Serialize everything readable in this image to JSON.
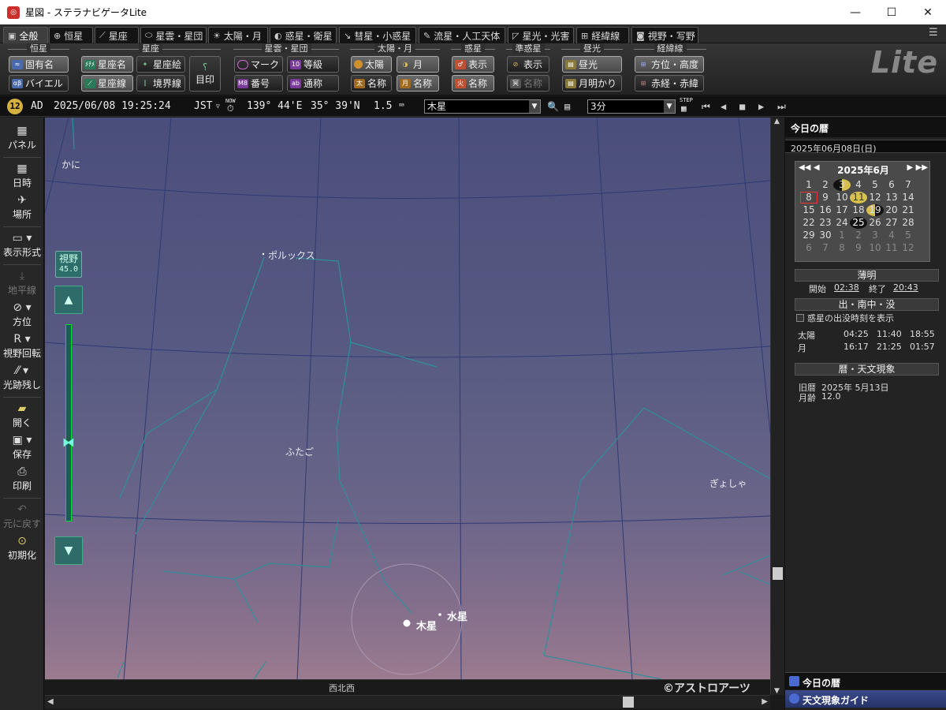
{
  "window": {
    "title": "星図 - ステラナビゲータLite",
    "icon": "stellanavi-app-icon"
  },
  "tabs": [
    {
      "label": "全般",
      "icon": "general-icon",
      "active": true
    },
    {
      "label": "恒星",
      "icon": "star-crosshair-icon"
    },
    {
      "label": "星座",
      "icon": "constellation-icon"
    },
    {
      "label": "星雲・星団",
      "icon": "nebula-icon"
    },
    {
      "label": "太陽・月",
      "icon": "sun-icon"
    },
    {
      "label": "惑星・衛星",
      "icon": "planet-icon"
    },
    {
      "label": "彗星・小惑星",
      "icon": "comet-icon"
    },
    {
      "label": "流星・人工天体",
      "icon": "meteor-icon"
    },
    {
      "label": "星光・光害",
      "icon": "starlight-icon"
    },
    {
      "label": "経緯線",
      "icon": "grid-icon"
    },
    {
      "label": "視野・写野",
      "icon": "camera-icon"
    }
  ],
  "ribbon": {
    "groups": {
      "star": "恒星",
      "constellation": "星座",
      "nebula": "星雲・星団",
      "sunmoon": "太陽・月",
      "planet": "惑星",
      "dwarf": "準惑星",
      "twilight": "昼光",
      "grid": "経緯線"
    },
    "buttons": {
      "proper_name": "固有名",
      "bayer": "バイエル",
      "const_name": "星座名",
      "const_line": "星座線",
      "const_art": "星座絵",
      "boundary": "境界線",
      "mark": "目印",
      "neb_mark": "マーク",
      "neb_number": "番号",
      "neb_magnitude": "等級",
      "neb_common": "通称",
      "sun": "太陽",
      "moon": "月",
      "sun_name": "名称",
      "moon_name": "名称",
      "planet_show": "表示",
      "planet_name": "名称",
      "dwarf_show": "表示",
      "dwarf_name": "名称",
      "daylight": "昼光",
      "moonlight": "月明かり",
      "altaz": "方位・高度",
      "radec": "赤経・赤緯"
    },
    "logo": "Lite"
  },
  "infobar": {
    "badge": "12",
    "era": "AD",
    "datetime": "2025/06/08 19:25:24",
    "tz": "JST",
    "now_label": "NOW",
    "longitude": "139° 44'E",
    "latitude": "35° 39'N",
    "speed": "1.5",
    "target": "木星",
    "step": "3分",
    "step_label": "STEP"
  },
  "leftbar": {
    "panel": "パネル",
    "datetime": "日時",
    "place": "場所",
    "display": "表示形式",
    "horizon": "地平線",
    "direction": "方位",
    "rotate": "視野回転",
    "trail": "光跡残し",
    "open": "開く",
    "save": "保存",
    "print": "印刷",
    "undo": "元に戻す",
    "reset": "初期化"
  },
  "sky": {
    "fov_label": "視野",
    "fov_value": "45.0",
    "labels": {
      "kani": "かに",
      "pollux": "ポルックス",
      "futago": "ふたご",
      "gyosha": "ぎょしゃ",
      "jupiter": "木星",
      "mercury": "水星"
    },
    "direction": "西北西",
    "copyright": "©アストロアーツ"
  },
  "right_panel": {
    "title": "今日の暦",
    "date": "2025年06月08日(日)",
    "calendar": {
      "month": "2025年6月",
      "days": [
        [
          "",
          "",
          "",
          "",
          "",
          "",
          ""
        ],
        [
          "1",
          "2",
          "3",
          "4",
          "5",
          "6",
          "7"
        ],
        [
          "8",
          "9",
          "10",
          "11",
          "12",
          "13",
          "14"
        ],
        [
          "15",
          "16",
          "17",
          "18",
          "19",
          "20",
          "21"
        ],
        [
          "22",
          "23",
          "24",
          "25",
          "26",
          "27",
          "28"
        ],
        [
          "29",
          "30",
          "1",
          "2",
          "3",
          "4",
          "5"
        ],
        [
          "6",
          "7",
          "8",
          "9",
          "10",
          "11",
          "12"
        ]
      ]
    },
    "twilight": {
      "head": "薄明",
      "start_label": "開始",
      "start": "02:38",
      "end_label": "終了",
      "end": "20:43"
    },
    "rise_set": {
      "head": "出・南中・没",
      "checkbox": "惑星の出没時刻を表示",
      "rows": [
        {
          "name": "太陽",
          "rise": "04:25",
          "transit": "11:40",
          "set": "18:55"
        },
        {
          "name": "月",
          "rise": "16:17",
          "transit": "21:25",
          "set": "01:57"
        }
      ]
    },
    "phenomena": {
      "head": "暦・天文現象",
      "lunar_label": "旧暦",
      "lunar_date": "2025年 5月13日",
      "age_label": "月齢",
      "age": "12.0"
    },
    "bottom1": "今日の暦",
    "bottom2": "天文現象ガイド"
  }
}
